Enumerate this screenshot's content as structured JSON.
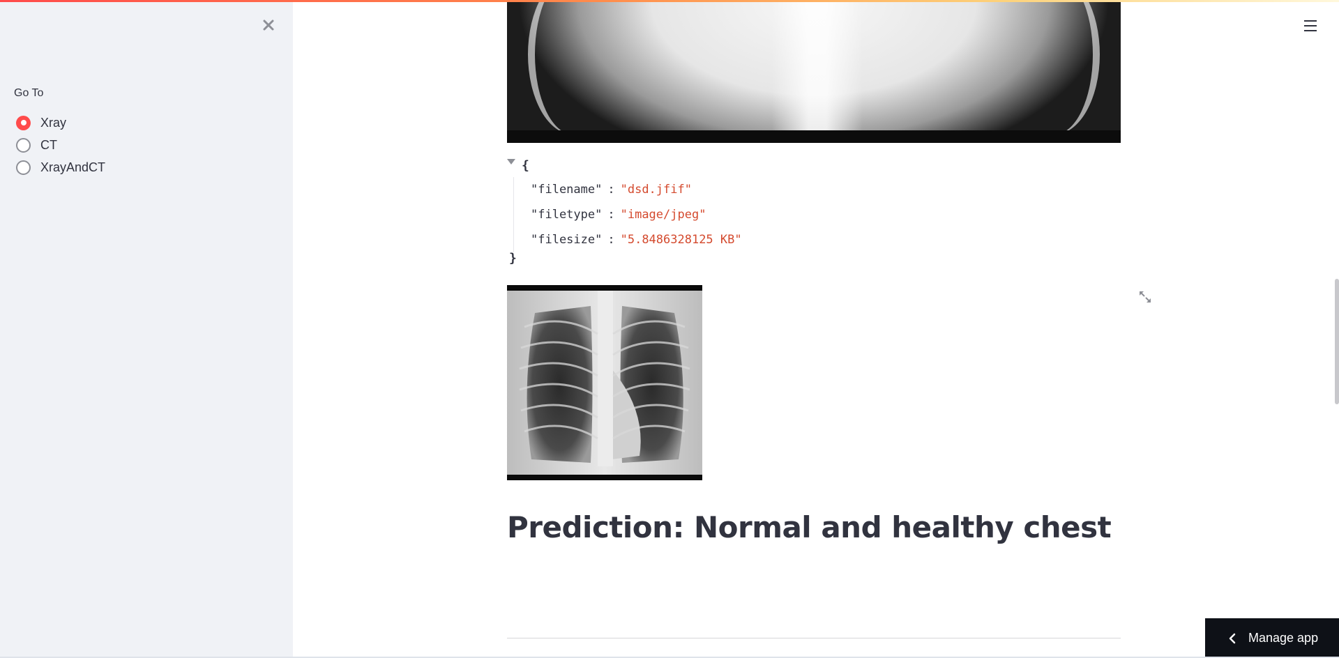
{
  "sidebar": {
    "goto_label": "Go To",
    "options": [
      {
        "label": "Xray",
        "selected": true
      },
      {
        "label": "CT",
        "selected": false
      },
      {
        "label": "XrayAndCT",
        "selected": false
      }
    ],
    "accent_color": "#ff4b4b"
  },
  "file_info": {
    "open_brace": "{",
    "close_brace": "}",
    "rows": [
      {
        "key": "\"filename\"",
        "value": "\"dsd.jfif\""
      },
      {
        "key": "\"filetype\"",
        "value": "\"image/jpeg\""
      },
      {
        "key": "\"filesize\"",
        "value": "\"5.8486328125 KB\""
      }
    ]
  },
  "prediction": {
    "text": "Prediction: Normal and healthy chest"
  },
  "manage_app": {
    "label": "Manage app"
  },
  "icons": {
    "sidebar_close": "close-icon",
    "main_menu": "hamburger-menu-icon",
    "expand": "fullscreen-icon",
    "manage_chevron": "chevron-left-icon",
    "json_toggle": "caret-down-icon"
  }
}
